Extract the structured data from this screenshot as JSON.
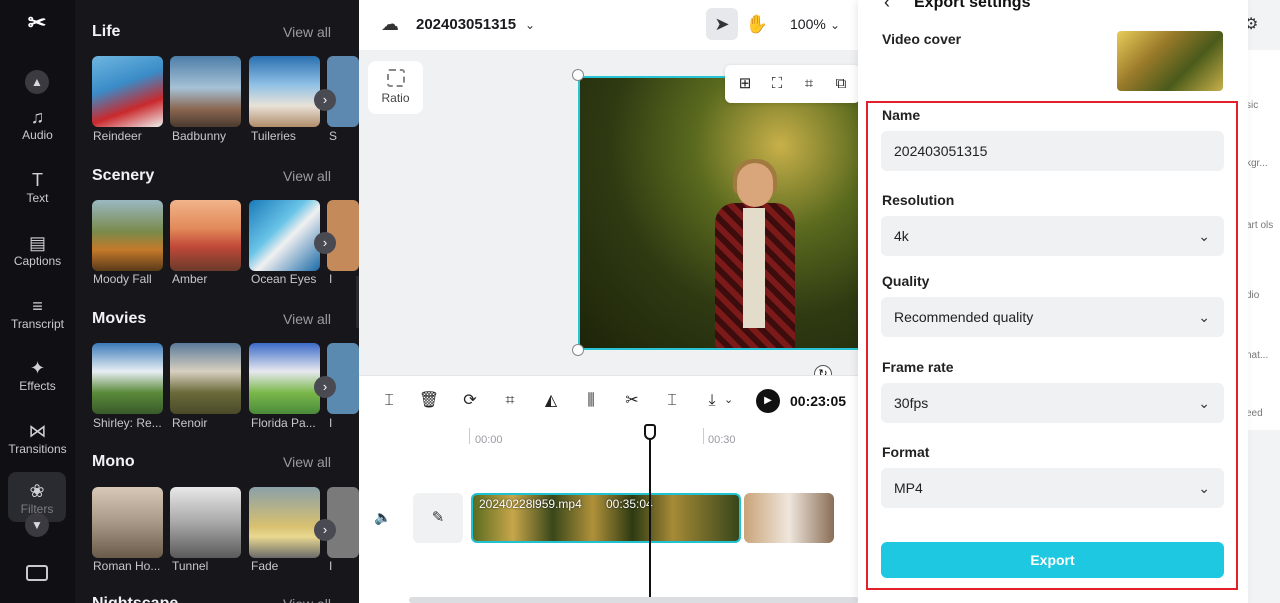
{
  "rail": {
    "items": [
      {
        "label": "Audio",
        "icon": "music-note-icon"
      },
      {
        "label": "Text",
        "icon": "text-icon"
      },
      {
        "label": "Captions",
        "icon": "captions-icon"
      },
      {
        "label": "Transcript",
        "icon": "transcript-icon"
      },
      {
        "label": "Effects",
        "icon": "effects-icon"
      },
      {
        "label": "Transitions",
        "icon": "transitions-icon"
      },
      {
        "label": "Filters",
        "icon": "filters-icon"
      }
    ]
  },
  "filters_panel": {
    "view_all_label": "View all",
    "sections": [
      {
        "title": "Life",
        "items": [
          "Reindeer",
          "Badbunny",
          "Tuileries",
          "S"
        ]
      },
      {
        "title": "Scenery",
        "items": [
          "Moody Fall",
          "Amber",
          "Ocean Eyes",
          "I"
        ]
      },
      {
        "title": "Movies",
        "items": [
          "Shirley: Re...",
          "Renoir",
          "Florida Pa...",
          "I"
        ]
      },
      {
        "title": "Mono",
        "items": [
          "Roman Ho...",
          "Tunnel",
          "Fade",
          "I"
        ]
      },
      {
        "title": "Nightscape",
        "items": []
      }
    ]
  },
  "topbar": {
    "project_name": "202403051315",
    "zoom": "100%"
  },
  "canvas": {
    "ratio_label": "Ratio"
  },
  "timeline": {
    "timecode": "00:23:05",
    "ruler": [
      "00:00",
      "00:30"
    ],
    "clip_name": "20240228l959.mp4",
    "clip_duration": "00:35:04"
  },
  "right_strip": {
    "labels": [
      "sic",
      "kgr...",
      "art\nols",
      "dio",
      "nat...",
      "eed"
    ]
  },
  "export_settings": {
    "title": "Export settings",
    "video_cover_label": "Video cover",
    "name_label": "Name",
    "name_value": "202403051315",
    "resolution_label": "Resolution",
    "resolution_value": "4k",
    "quality_label": "Quality",
    "quality_value": "Recommended quality",
    "frame_rate_label": "Frame rate",
    "frame_rate_value": "30fps",
    "format_label": "Format",
    "format_value": "MP4",
    "export_button": "Export"
  },
  "colors": {
    "accent": "#1ec8e0",
    "highlight_border": "#e21f2a",
    "selection": "#28c4d3"
  }
}
